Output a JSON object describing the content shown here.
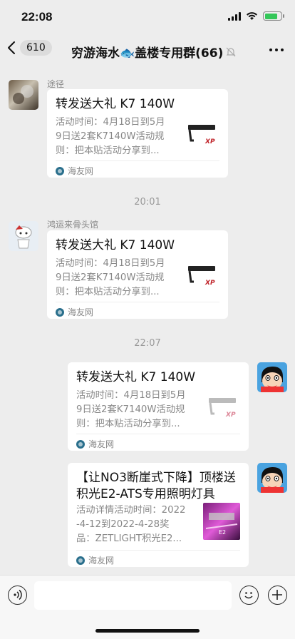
{
  "status_bar": {
    "time": "22:08",
    "battery_level": 0.8,
    "charging": true
  },
  "nav": {
    "back_count": "610",
    "title": "穷游海水🐟盖楼专用群(66)",
    "muted": true
  },
  "messages": [
    {
      "sender": "途径",
      "card": {
        "title": "转发送大礼 K7 140W",
        "desc": "活动时间：4月18日到5月\n9日送2套K7140W活动规\n则：把本贴活动分享到...",
        "source": "海友网"
      }
    },
    {
      "sender": "鸿运来骨头馆",
      "card": {
        "title": "转发送大礼 K7 140W",
        "desc": "活动时间：4月18日到5月\n9日送2套K7140W活动规\n则：把本贴活动分享到...",
        "source": "海友网"
      }
    },
    {
      "sender": "",
      "card": {
        "title": "转发送大礼 K7 140W",
        "desc": "活动时间：4月18日到5月\n9日送2套K7140W活动规\n则：把本贴活动分享到...",
        "source": "海友网"
      }
    },
    {
      "sender": "",
      "card": {
        "title": "【让NO3断崖式下降】顶楼送\n积光E2-ATS专用照明灯具",
        "desc": "活动详情活动时间：2022\n-4-12到2022-4-28奖\n品：ZETLIGHT积光E2...",
        "source": "海友网"
      }
    }
  ],
  "time_separators": [
    "20:01",
    "22:07"
  ],
  "input_bar": {
    "placeholder": ""
  },
  "colors": {
    "background": "#ededed",
    "card": "#ffffff",
    "muted_text": "#888888"
  }
}
